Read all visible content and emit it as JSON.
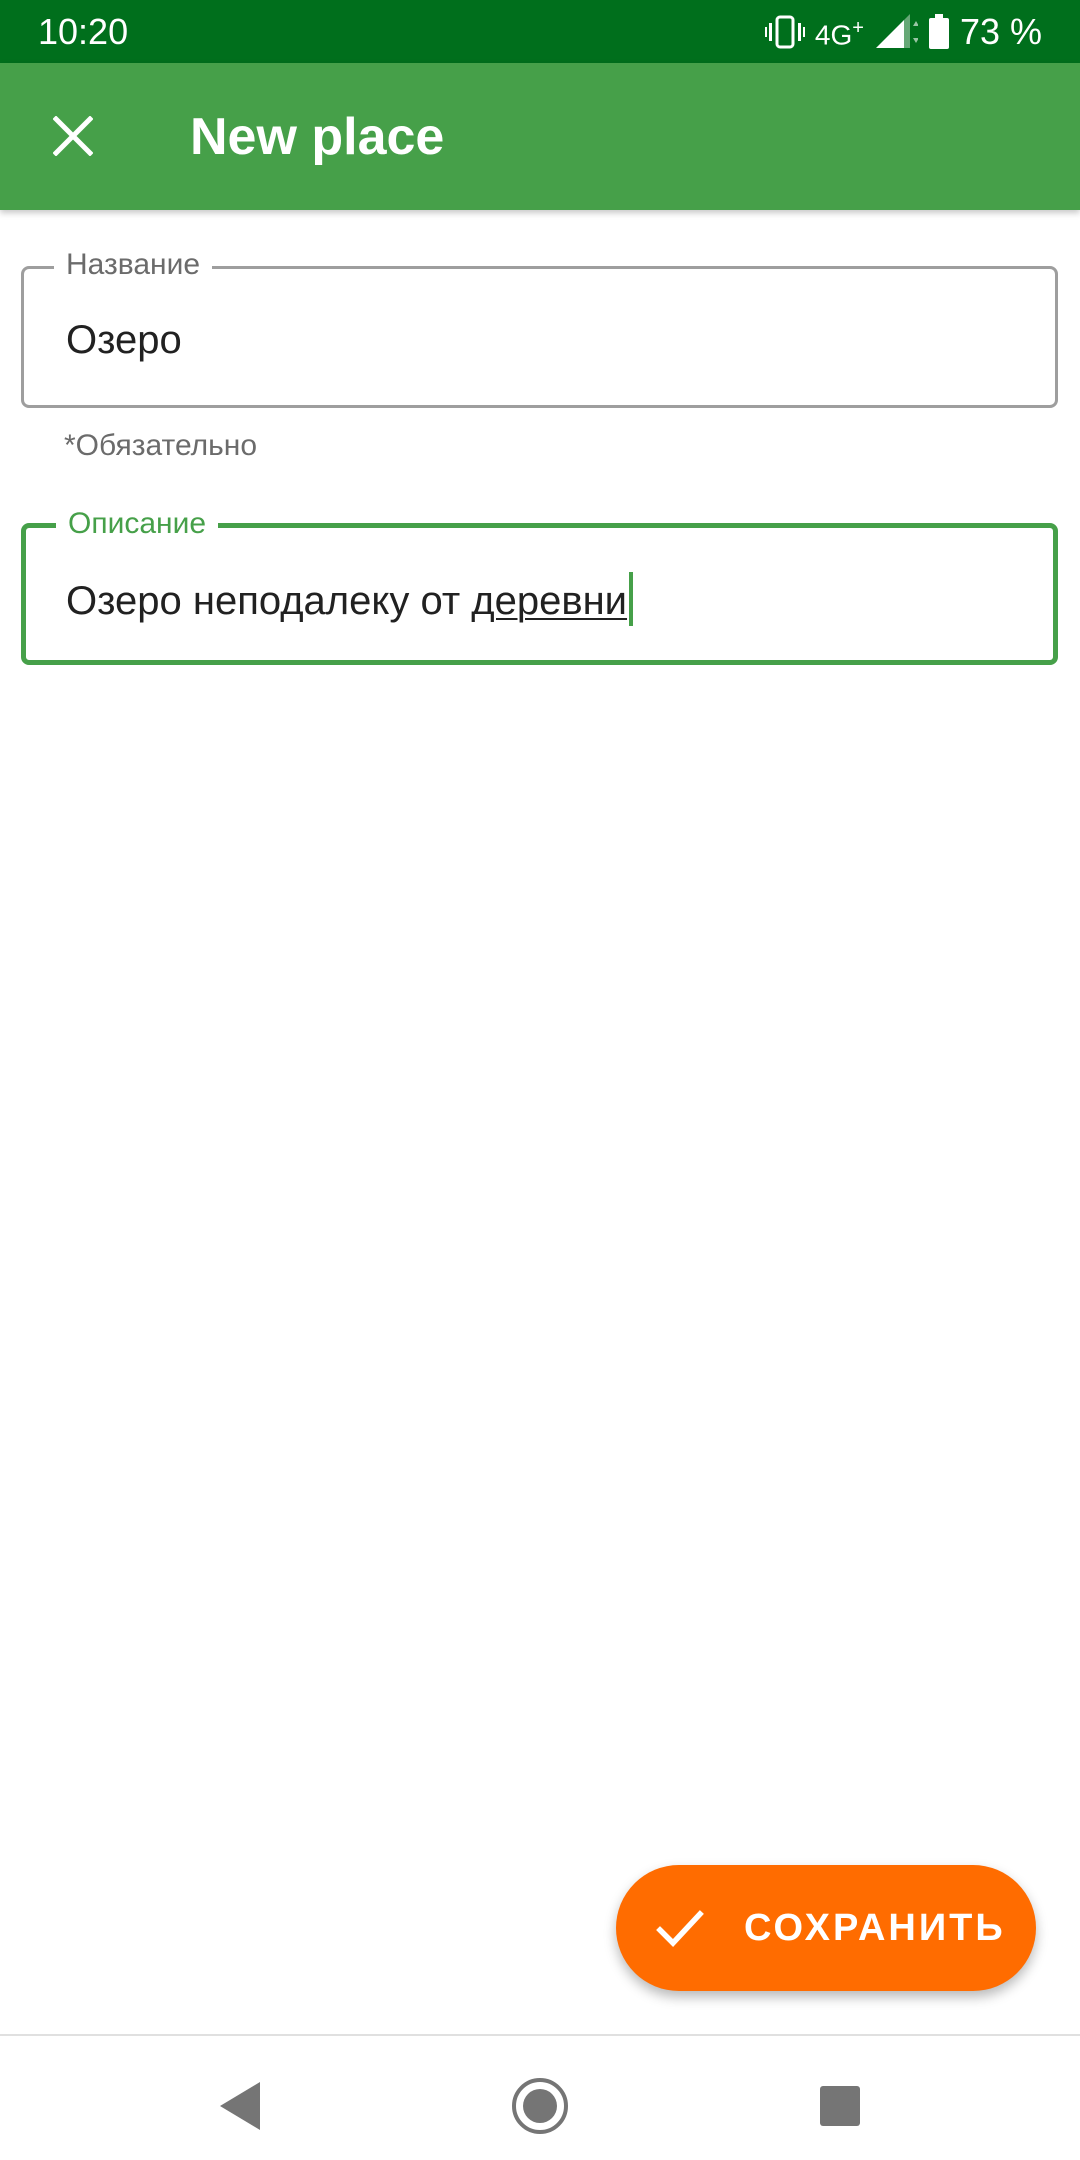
{
  "status_bar": {
    "time": "10:20",
    "network": "4G",
    "network_sup": "+",
    "battery": "73 %",
    "icons": [
      "vibrate-icon",
      "signal-icon",
      "battery-icon"
    ]
  },
  "app_bar": {
    "title": "New place",
    "close_icon": "close-icon",
    "background": "#46a049"
  },
  "form": {
    "name_field": {
      "label": "Название",
      "value": "Озеро",
      "helper": "*Обязательно"
    },
    "description_field": {
      "label": "Описание",
      "value_prefix": "Озеро неподалеку от ",
      "value_composing": "деревни",
      "focused": true
    }
  },
  "fab": {
    "label": "СОХРАНИТЬ",
    "icon": "check-icon",
    "color": "#ff6c00"
  },
  "nav_bar": {
    "buttons": [
      "back-icon",
      "home-icon",
      "recents-icon"
    ]
  }
}
